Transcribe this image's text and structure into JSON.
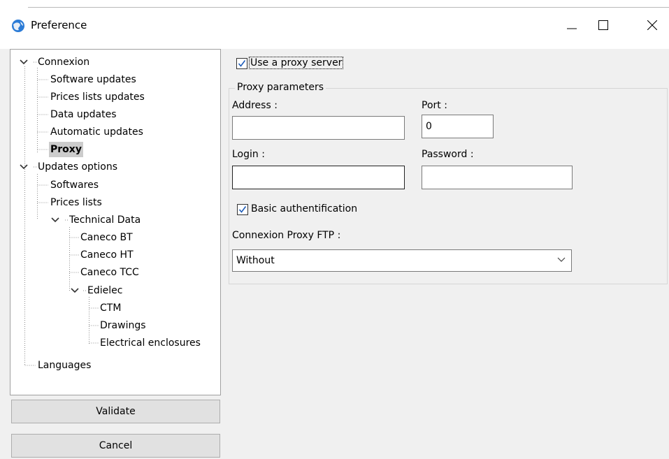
{
  "window": {
    "title": "Preference",
    "icon": "globe-icon",
    "controls": {
      "minimize": "minimize-icon",
      "maximize": "maximize-icon",
      "close": "close-icon"
    }
  },
  "tree": {
    "items": [
      {
        "label": "Connexion",
        "level": 0,
        "expanded": true
      },
      {
        "label": "Software updates",
        "level": 1
      },
      {
        "label": "Prices lists updates",
        "level": 1
      },
      {
        "label": "Data updates",
        "level": 1
      },
      {
        "label": "Automatic updates",
        "level": 1
      },
      {
        "label": "Proxy",
        "level": 1,
        "selected": true
      },
      {
        "label": "Updates options",
        "level": 0,
        "expanded": true
      },
      {
        "label": "Softwares",
        "level": 1
      },
      {
        "label": "Prices lists",
        "level": 1
      },
      {
        "label": "Technical Data",
        "level": 1,
        "expanded": true
      },
      {
        "label": "Caneco BT",
        "level": 2
      },
      {
        "label": "Caneco HT",
        "level": 2
      },
      {
        "label": "Caneco TCC",
        "level": 2
      },
      {
        "label": "Edielec",
        "level": 2,
        "expanded": true
      },
      {
        "label": "CTM",
        "level": 3
      },
      {
        "label": "Drawings",
        "level": 3
      },
      {
        "label": "Electrical enclosures",
        "level": 3
      },
      {
        "label": "Languages",
        "level": 0
      }
    ]
  },
  "buttons": {
    "validate": "Validate",
    "cancel": "Cancel"
  },
  "proxy": {
    "use_proxy_label": "Use a proxy server",
    "use_proxy_checked": true,
    "group_title": "Proxy parameters",
    "address_label": "Address :",
    "address_value": "",
    "port_label": "Port :",
    "port_value": "0",
    "login_label": "Login :",
    "login_value": "",
    "password_label": "Password :",
    "password_value": "",
    "basic_auth_label": "Basic authentification",
    "basic_auth_checked": true,
    "ftp_label": "Connexion Proxy FTP :",
    "ftp_selected": "Without"
  },
  "colors": {
    "checkbox_check": "#1c5bb8",
    "selection": "#cccccc"
  }
}
